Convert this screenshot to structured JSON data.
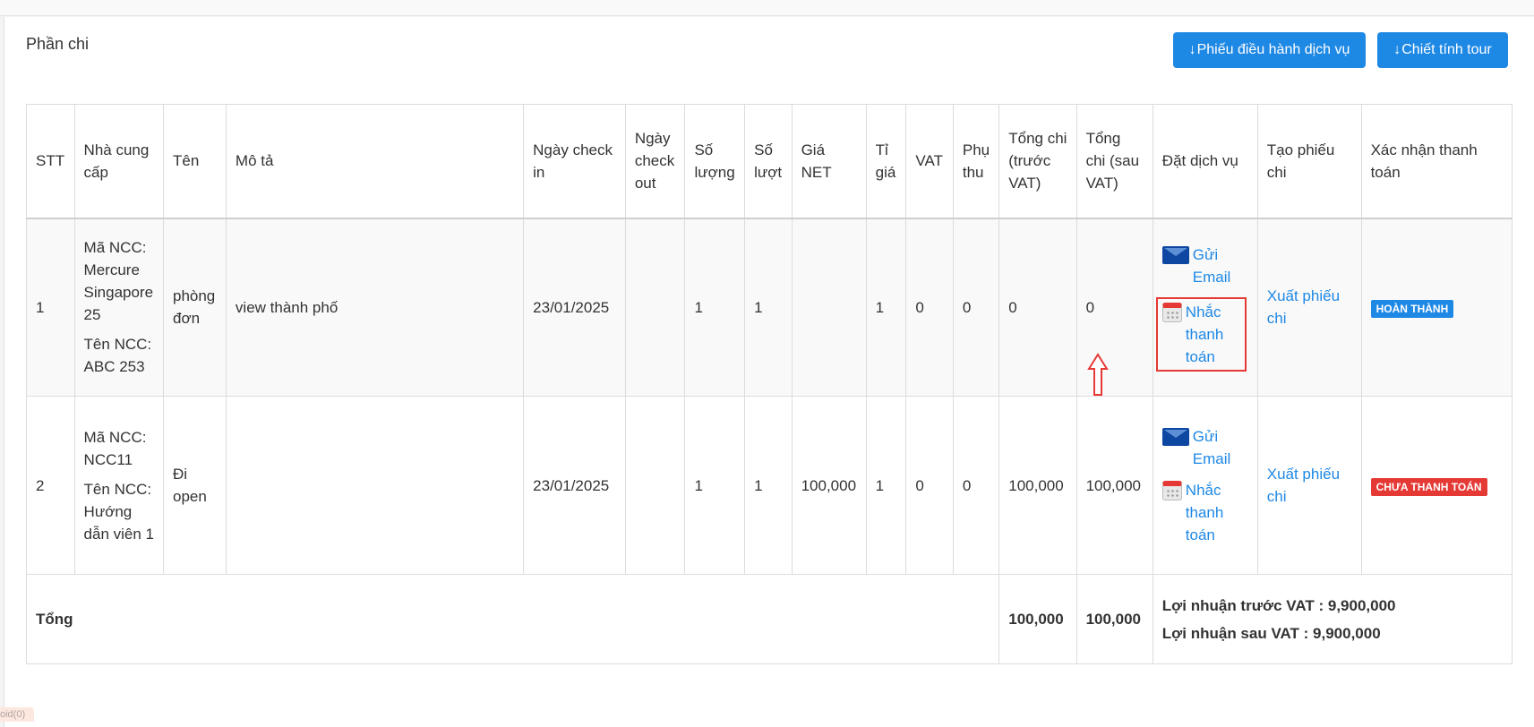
{
  "section": {
    "title": "Phần chi"
  },
  "buttons": {
    "service_order": "Phiếu điều hành dịch vụ",
    "tour_cost": "Chiết tính tour",
    "arrow_glyph": "↓"
  },
  "table": {
    "headers": {
      "stt": "STT",
      "supplier": "Nhà cung cấp",
      "name": "Tên",
      "description": "Mô tả",
      "checkin": "Ngày check in",
      "checkout": "Ngày check out",
      "quantity": "Số lượng",
      "turns": "Số lượt",
      "net_price": "Giá NET",
      "rate": "Tỉ giá",
      "vat": "VAT",
      "surcharge": "Phụ thu",
      "total_before": "Tổng chi (trước VAT)",
      "total_after": "Tổng chi (sau VAT)",
      "booking": "Đặt dịch vụ",
      "create_voucher": "Tạo phiếu chi",
      "confirm_payment": "Xác nhận thanh toán"
    },
    "rows": [
      {
        "stt": "1",
        "supplier_code": "Mã NCC: Mercure Singapore 25",
        "supplier_name": "Tên NCC: ABC 253",
        "name": "phòng đơn",
        "description": "view thành phố",
        "checkin": "23/01/2025",
        "checkout": "",
        "quantity": "1",
        "turns": "1",
        "net_price": "",
        "rate": "1",
        "vat": "0",
        "surcharge": "0",
        "total_before": "0",
        "total_after": "0",
        "send_email": "Gửi Email",
        "remind_payment": "Nhắc thanh toán",
        "export_voucher": "Xuất phiếu chi",
        "status": "HOÀN THÀNH",
        "status_color": "#1e88e5"
      },
      {
        "stt": "2",
        "supplier_code": "Mã NCC: NCC11",
        "supplier_name": "Tên NCC: Hướng dẫn viên 1",
        "name": "Đi open",
        "description": "",
        "checkin": "23/01/2025",
        "checkout": "",
        "quantity": "1",
        "turns": "1",
        "net_price": "100,000",
        "rate": "1",
        "vat": "0",
        "surcharge": "0",
        "total_before": "100,000",
        "total_after": "100,000",
        "send_email": "Gửi Email",
        "remind_payment": "Nhắc thanh toán",
        "export_voucher": "Xuất phiếu chi",
        "status": "CHƯA THANH TOÁN",
        "status_color": "#e53935"
      }
    ],
    "footer": {
      "label": "Tổng",
      "total_before": "100,000",
      "total_after": "100,000",
      "profit_before": "Lợi nhuận trước VAT : 9,900,000",
      "profit_after": "Lợi nhuận sau VAT : 9,900,000"
    }
  },
  "icons": {
    "mail": "mail-icon",
    "calendar": "calendar-icon",
    "arrow": "up-arrow-icon"
  },
  "status_bar": {
    "text": "oid(0)"
  }
}
